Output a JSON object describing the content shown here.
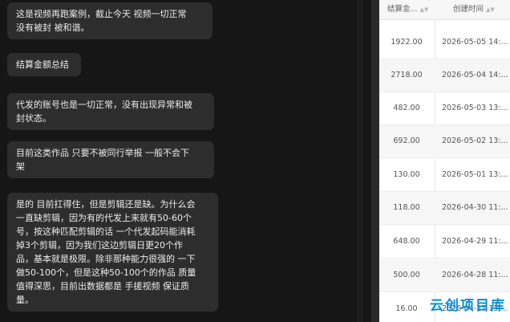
{
  "chat": {
    "messages": [
      "这是视频再跑案例，截止今天 视频一切正常\n没有被封 被和谐。",
      "结算金额总结",
      "代发的账号也是一切正常，没有出现异常和被\n封状态。",
      "目前这类作品 只要不被同行举报 一般不会下\n架",
      "是的 目前扛得住，但是剪辑还是缺。为什么会\n一直缺剪辑，因为有的代发上来就有50-60个\n号，按这种匹配剪辑的话 一个代发起码能消耗\n掉3个剪辑，因为我们这边剪辑日更20个作\n品，基本就是极限。除非那种能力很强的 一下\n做50-100个，但是这种50-100个的作品 质量\n值得深思，目前出数据都是 手搓视频 保证质\n量。"
    ]
  },
  "table": {
    "headers": {
      "amount": "结算金...",
      "time": "创建时间"
    },
    "rows": [
      {
        "amount": "1922.00",
        "time": "2026-05-05 14:..."
      },
      {
        "amount": "2718.00",
        "time": "2026-05-04 14:..."
      },
      {
        "amount": "482.00",
        "time": "2026-05-03 13:..."
      },
      {
        "amount": "692.00",
        "time": "2026-05-02 13:..."
      },
      {
        "amount": "130.00",
        "time": "2026-05-01 13:..."
      },
      {
        "amount": "118.00",
        "time": "2026-04-30 11:..."
      },
      {
        "amount": "648.00",
        "time": "2026-04-29 11:..."
      },
      {
        "amount": "500.00",
        "time": "2026-04-28 11:..."
      },
      {
        "amount": "16.00",
        "time": "2026-04-27 13:..."
      }
    ]
  },
  "watermark": "云创项目库",
  "colors": {
    "accent": "#0a8fd6",
    "bubble": "#2d2d2d",
    "background": "#161616"
  }
}
